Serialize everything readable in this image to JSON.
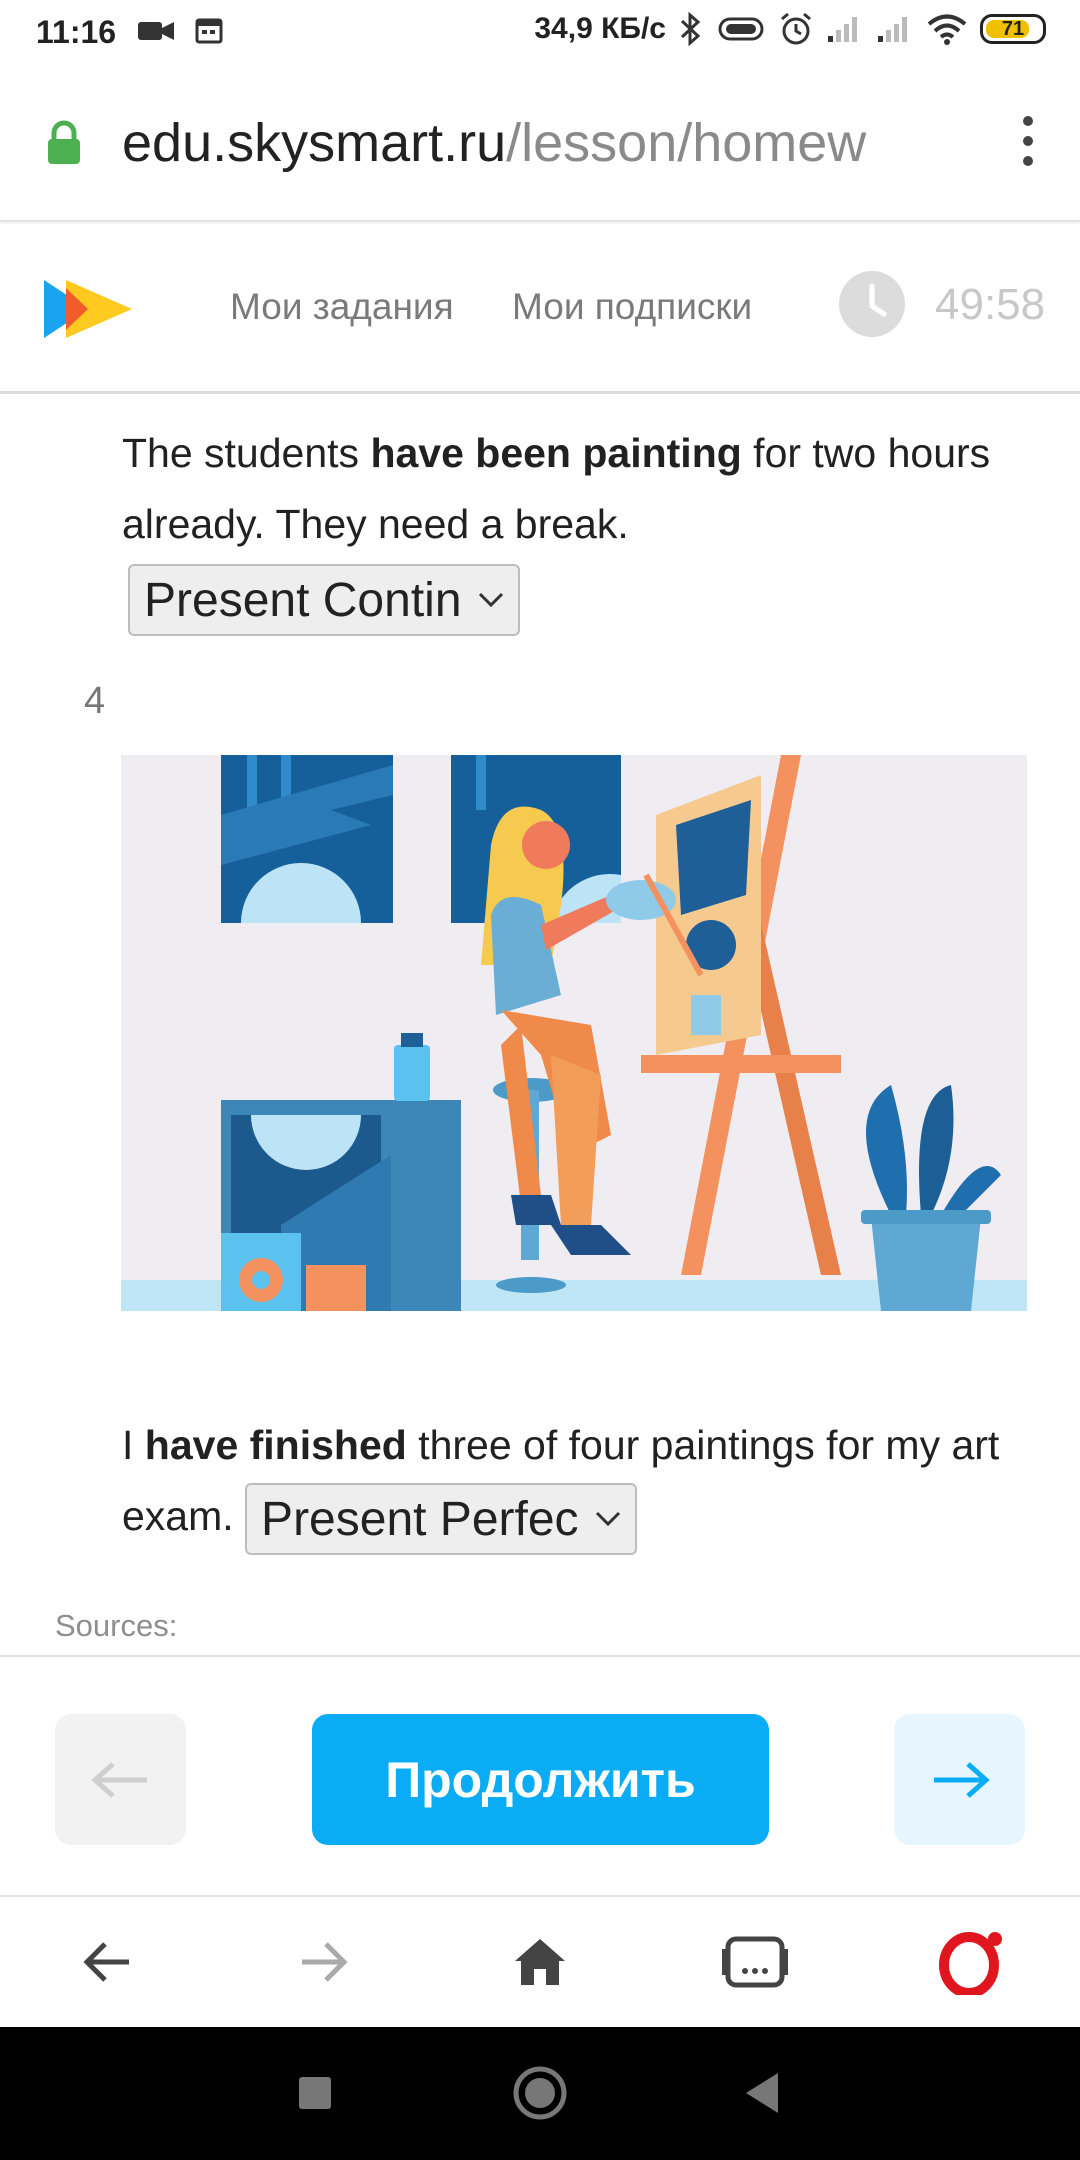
{
  "status_bar": {
    "time": "11:16",
    "net_speed": "34,9 КБ/с",
    "battery": "71"
  },
  "browser": {
    "url_host": "edu.skysmart.ru",
    "url_path": "/lesson/homew"
  },
  "header": {
    "nav_tasks": "Мои задания",
    "nav_subscriptions": "Мои подписки",
    "timer": "49:58"
  },
  "task3": {
    "text_before": "The students ",
    "text_bold": "have been painting",
    "text_after": " for two hours already. They need a break.",
    "select_value": "Present Contin"
  },
  "task4": {
    "number": "4",
    "text_before": "I ",
    "text_bold": "have finished",
    "text_after": " three of four paintings for my art exam. ",
    "select_value": "Present Perfec"
  },
  "sources_label": "Sources:",
  "buttons": {
    "continue_label": "Продолжить"
  },
  "colors": {
    "accent_blue": "#0aacf5",
    "lock_green": "#4caf50",
    "opera_red": "#e0161e"
  }
}
